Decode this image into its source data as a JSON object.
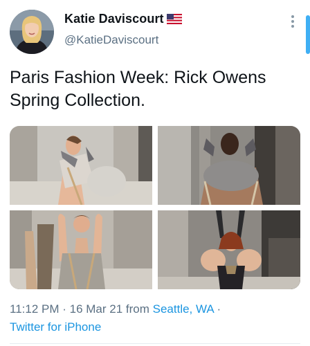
{
  "author": {
    "display_name": "Katie Daviscourt",
    "handle": "@KatieDaviscourt",
    "flag_icon": "us-flag-icon"
  },
  "tweet": {
    "text": "Paris Fashion Week: Rick Owens Spring Collection."
  },
  "media": [
    {
      "name": "runway-photo-1"
    },
    {
      "name": "runway-photo-2"
    },
    {
      "name": "runway-photo-3"
    },
    {
      "name": "runway-photo-4"
    }
  ],
  "meta": {
    "time": "11:12 PM",
    "separator": " · ",
    "date": "16 Mar 21",
    "from_label": " from ",
    "location": "Seattle, WA",
    "source": "Twitter for iPhone"
  },
  "colors": {
    "link": "#1b95e0",
    "muted": "#5b7083",
    "text": "#0f1419"
  }
}
